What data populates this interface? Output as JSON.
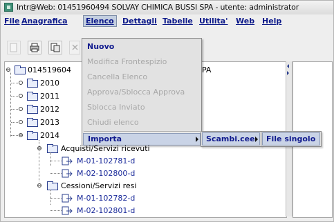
{
  "window": {
    "title": "Intr@Web: 01451960494  SOLVAY CHIMICA BUSSI SPA - utente: administrator"
  },
  "menubar": {
    "items": [
      {
        "label": "File"
      },
      {
        "label": "Anagrafica"
      },
      {
        "label": "Elenco"
      },
      {
        "label": "Dettagli"
      },
      {
        "label": "Tabelle"
      },
      {
        "label": "Utilita'"
      },
      {
        "label": "Web"
      },
      {
        "label": "Help"
      }
    ],
    "active": "Elenco"
  },
  "toolbar": {
    "buttons": [
      {
        "icon": "document-disabled-icon"
      },
      {
        "icon": "print-icon"
      },
      {
        "icon": "copy-document-icon"
      },
      {
        "icon": "close-icon"
      }
    ]
  },
  "tree": {
    "root_label": "014519604",
    "root_suffix": "PA",
    "years": [
      "2010",
      "2011",
      "2012",
      "2013",
      "2014"
    ],
    "group_acquisti": "Acquisti/Servizi ricevuti",
    "group_cessioni": "Cessioni/Servizi resi",
    "acquisti_items": [
      "M-01-102781-d",
      "M-02-102800-d"
    ],
    "cessioni_items": [
      "M-01-102782-d",
      "M-02-102801-d"
    ]
  },
  "elenco_menu": {
    "items": [
      {
        "label": "Nuovo",
        "enabled": true
      },
      {
        "label": "Modifica Frontespizio",
        "enabled": false
      },
      {
        "label": "Cancella Elenco",
        "enabled": false
      },
      {
        "label": "Approva/Sblocca Approva",
        "enabled": false
      },
      {
        "label": "Sblocca Inviato",
        "enabled": false
      },
      {
        "label": "Chiudi elenco",
        "enabled": false
      }
    ],
    "importa": "Importa"
  },
  "submenu_importa": {
    "item": "Scambi.cee"
  },
  "submenu_scambi": {
    "item": "File singolo"
  },
  "colors": {
    "menu_text": "#0d1a8a",
    "highlight": "#c9d3e6",
    "disabled": "#a8a8a8",
    "folder_border": "#2b3f8f"
  }
}
